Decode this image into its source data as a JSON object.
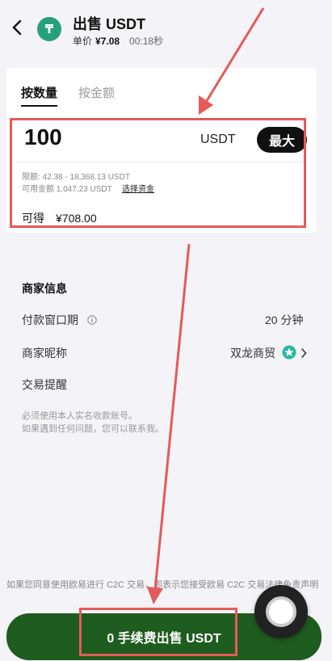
{
  "header": {
    "title": "出售 USDT",
    "price_label": "单价",
    "price_value": "¥7.08",
    "timer": "00:18秒",
    "coin_symbol": "₸"
  },
  "tabs": [
    {
      "label": "按数量",
      "active": true
    },
    {
      "label": "按金额",
      "active": false
    }
  ],
  "amount": {
    "value": "100",
    "unit": "USDT",
    "max_label": "最大",
    "limit_text": "限额: 42.38 - 18,368.13 USDT",
    "available_text": "可用金额 1,047.23 USDT",
    "choose_funds": "选择资金",
    "receive_label": "可得",
    "receive_value": "¥708.00"
  },
  "merchant": {
    "section_title": "商家信息",
    "payment_window_label": "付款窗口期",
    "payment_window_value": "20 分钟",
    "nickname_label": "商家昵称",
    "nickname_value": "双龙商贸",
    "reminder_label": "交易提醒",
    "reminder_lines": [
      "必须使用本人实名收款账号。",
      "如果遇到任何问题，您可以联系我。"
    ]
  },
  "footer": {
    "disclaimer": "如果您同意使用欧易进行 C2C 交易，即表示您接受欧易 C2C 交易法律免责声明",
    "sell_button": "0 手续费出售 USDT"
  },
  "colors": {
    "accent_green": "#1f5c1f",
    "tether_green": "#26a17b",
    "annotation_red": "#e55a5a",
    "background": "#f4f3f7"
  },
  "icons": [
    "back-chevron-icon",
    "usdt-coin-icon",
    "info-icon",
    "verified-badge-icon",
    "chevron-right-icon"
  ]
}
